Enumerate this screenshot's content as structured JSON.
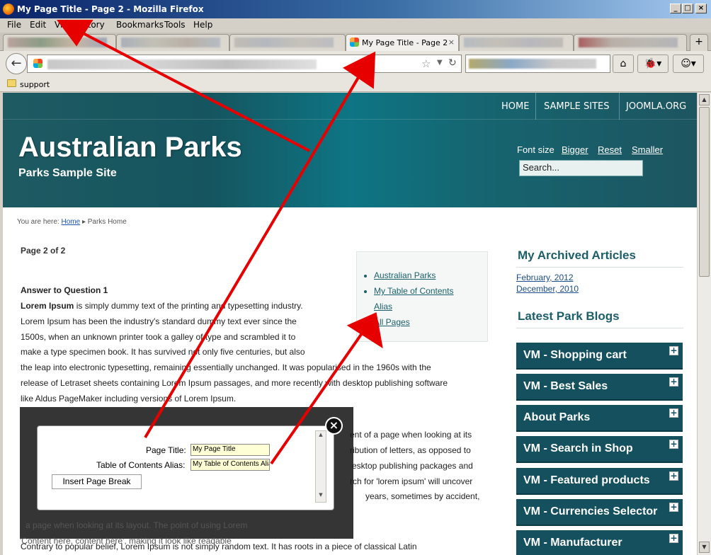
{
  "window": {
    "title": "My Page Title - Page 2 - Mozilla Firefox",
    "min": "_",
    "max": "□",
    "close": "×"
  },
  "menu": [
    "File",
    "Edit",
    "View",
    "History",
    "Bookmarks",
    "Tools",
    "Help"
  ],
  "tabs": {
    "active_label": "My Page Title - Page 2",
    "close": "×",
    "new_tab": "+"
  },
  "nav": {
    "back": "←",
    "home": "⌂"
  },
  "bookmarks": {
    "folder_label": "support"
  },
  "site": {
    "topnav": [
      "HOME",
      "SAMPLE SITES",
      "JOOMLA.ORG"
    ],
    "title": "Australian Parks",
    "subtitle": "Parks Sample Site",
    "fontsize_label": "Font size",
    "fontsize_links": [
      "Bigger",
      "Reset",
      "Smaller"
    ],
    "search_value": "Search..."
  },
  "breadcrumb": {
    "prefix": "You are here:",
    "home": "Home",
    "sep": "▸",
    "current": "Parks Home"
  },
  "article": {
    "page_count": "Page 2 of 2",
    "toc": [
      "Australian Parks",
      "My Table of Contents",
      "Alias",
      "All Pages"
    ],
    "question": "Answer to Question 1",
    "lead_bold": "Lorem Ipsum",
    "line1": " is simply dummy text of the printing and typesetting industry.",
    "line2": "Lorem Ipsum has been the industry's standard dummy text ever since the",
    "line3": "1500s, when an unknown printer took a galley of type and scrambled it to",
    "line4": "make a type specimen book. It has survived not only five centuries, but also",
    "line5": "the leap into electronic typesetting, remaining essentially unchanged. It was popularised in the 1960s with the",
    "line6": "release of Letraset sheets containing Lorem Ipsum passages, and more recently with desktop publishing software",
    "line7": "like Aldus PageMaker including versions of Lorem Ipsum.",
    "r1": "ent of a page when looking at its",
    "r2": "ribution of letters, as opposed to",
    "r3": "esktop publishing packages and",
    "r4": "rch for 'lorem ipsum' will uncover",
    "r5": "years, sometimes by accident,",
    "u1": "a page when looking at its layout. The point of using Lorem",
    "u2": "'Content here, content here', making it look like readable",
    "bottom": "Contrary to popular belief, Lorem Ipsum is not simply random text. It has roots in a piece of classical Latin"
  },
  "sidebar": {
    "archived_heading": "My Archived Articles",
    "archived": [
      "February, 2012",
      "December, 2010"
    ],
    "blogs_heading": "Latest Park Blogs",
    "modules": [
      "VM - Shopping cart",
      "VM - Best Sales",
      "About Parks",
      "VM - Search in Shop",
      "VM - Featured products",
      "VM - Currencies Selector",
      "VM - Manufacturer"
    ],
    "plus": "+"
  },
  "modal": {
    "page_title_label": "Page Title:",
    "page_title_value": "My Page Title",
    "toc_alias_label": "Table of Contents Alias:",
    "toc_alias_value": "My Table of Contents Alias",
    "button": "Insert Page Break",
    "close": "×"
  },
  "colors": {
    "annotation_arrow": "#e60000",
    "header_teal": "#15555f",
    "module_bg": "#14505e"
  }
}
